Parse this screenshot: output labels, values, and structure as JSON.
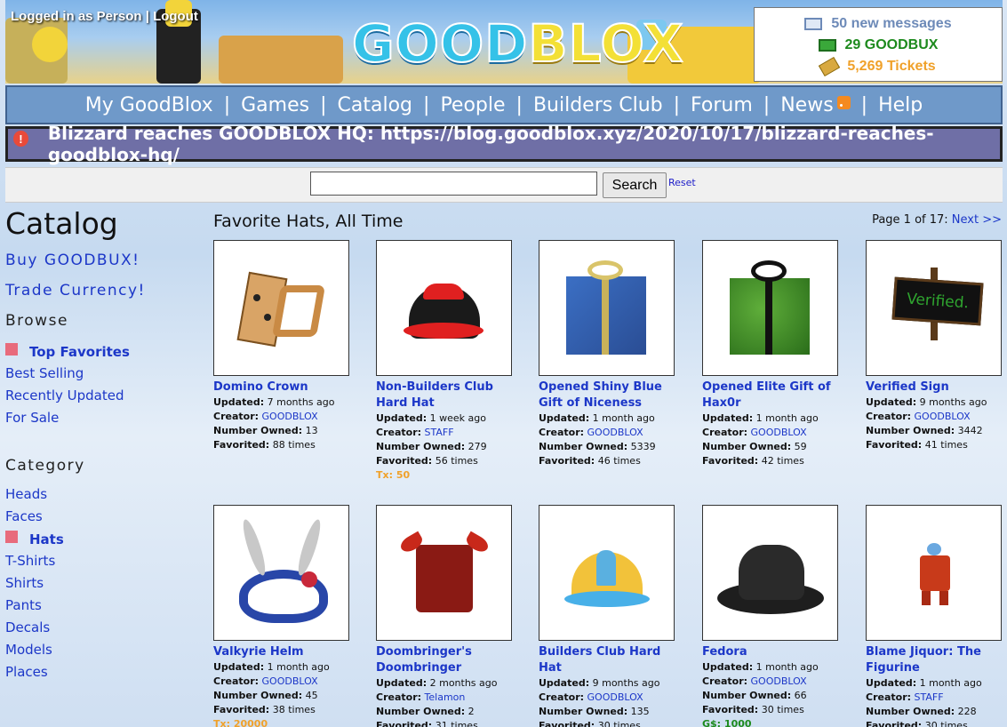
{
  "header": {
    "login_text": "Logged in as Person | ",
    "logout_label": "Logout",
    "logo_good": "GOOD",
    "logo_blox": "BLOX",
    "messages": "50 new messages",
    "goodbux": "29 GOODBUX",
    "tickets": "5,269 Tickets"
  },
  "nav": {
    "items": [
      "My GoodBlox",
      "Games",
      "Catalog",
      "People",
      "Builders Club",
      "Forum",
      "News",
      "Help"
    ]
  },
  "alert": {
    "text": "Blizzard reaches GOODBLOX HQ: https://blog.goodblox.xyz/2020/10/17/blizzard-reaches-goodblox-hq/"
  },
  "search": {
    "button": "Search",
    "reset": "Reset",
    "value": ""
  },
  "sidebar": {
    "title": "Catalog",
    "buy": "Buy GOODBUX!",
    "trade": "Trade Currency!",
    "browse_head": "Browse",
    "browse": [
      "Top Favorites",
      "Best Selling",
      "Recently Updated",
      "For Sale"
    ],
    "browse_active": 0,
    "category_head": "Category",
    "categories": [
      "Heads",
      "Faces",
      "Hats",
      "T-Shirts",
      "Shirts",
      "Pants",
      "Decals",
      "Models",
      "Places"
    ],
    "category_active": 2
  },
  "main": {
    "title": "Favorite Hats, All Time",
    "page_text": "Page 1 of 17: ",
    "next": "Next >>"
  },
  "labels": {
    "updated": "Updated:",
    "creator": "Creator:",
    "owned": "Number Owned:",
    "favorited": "Favorited:"
  },
  "items": [
    {
      "name": "Domino Crown",
      "updated": "7 months ago",
      "creator": "GOODBLOX",
      "owned": "13",
      "favorited": "88 times",
      "price": ""
    },
    {
      "name": "Non-Builders Club Hard Hat",
      "updated": "1 week ago",
      "creator": "STAFF",
      "owned": "279",
      "favorited": "56 times",
      "price": "Tx: 50"
    },
    {
      "name": "Opened Shiny Blue Gift of Niceness",
      "updated": "1 month ago",
      "creator": "GOODBLOX",
      "owned": "5339",
      "favorited": "46 times",
      "price": ""
    },
    {
      "name": "Opened Elite Gift of Hax0r",
      "updated": "1 month ago",
      "creator": "GOODBLOX",
      "owned": "59",
      "favorited": "42 times",
      "price": ""
    },
    {
      "name": "Verified Sign",
      "updated": "9 months ago",
      "creator": "GOODBLOX",
      "owned": "3442",
      "favorited": "41 times",
      "price": ""
    },
    {
      "name": "Valkyrie Helm",
      "updated": "1 month ago",
      "creator": "GOODBLOX",
      "owned": "45",
      "favorited": "38 times",
      "price": "Tx: 20000"
    },
    {
      "name": "Doombringer's Doombringer",
      "updated": "2 months ago",
      "creator": "Telamon",
      "owned": "2",
      "favorited": "31 times",
      "price": ""
    },
    {
      "name": "Builders Club Hard Hat",
      "updated": "9 months ago",
      "creator": "GOODBLOX",
      "owned": "135",
      "favorited": "30 times",
      "price": ""
    },
    {
      "name": "Fedora",
      "updated": "1 month ago",
      "creator": "GOODBLOX",
      "owned": "66",
      "favorited": "30 times",
      "price": "G$: 1000"
    },
    {
      "name": "Blame Jiquor: The Figurine",
      "updated": "1 month ago",
      "creator": "STAFF",
      "owned": "228",
      "favorited": "30 times",
      "price": ""
    }
  ],
  "verified_sign_text": "Verified."
}
